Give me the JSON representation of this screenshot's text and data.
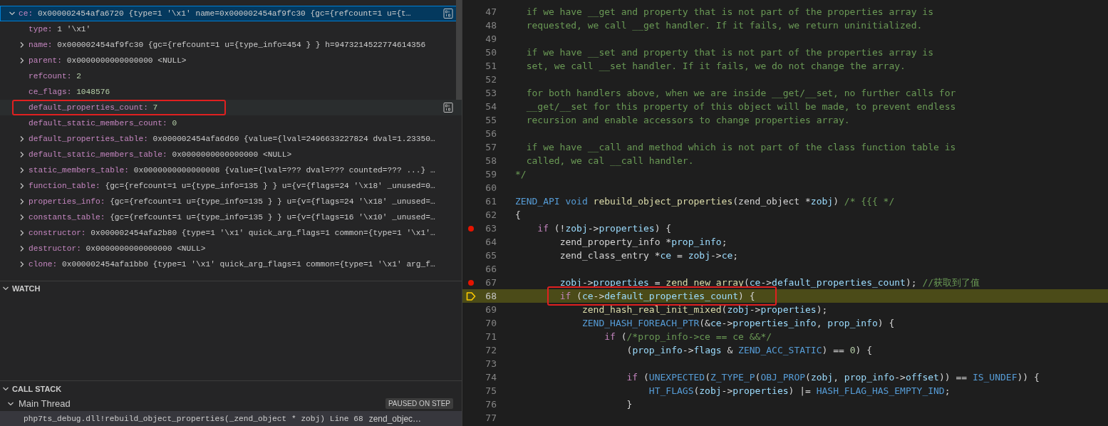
{
  "variables": {
    "items": [
      {
        "name": "ce:",
        "value": "0x000002454afa6720 {type=1 '\\x1' name=0x000002454af9fc30 {gc={refcount=1 u={t…",
        "kind": "text",
        "expandable": true,
        "expanded": true,
        "selected": true,
        "hovered": false,
        "annotated": false,
        "children": [
          {
            "name": "type:",
            "value": "1 '\\x1'",
            "kind": "text",
            "expandable": false,
            "selected": false,
            "hovered": false,
            "annotated": false
          },
          {
            "name": "name:",
            "value": "0x000002454af9fc30 {gc={refcount=1 u={type_info=454 } } h=9473214522774614356",
            "kind": "text",
            "expandable": true,
            "expanded": false,
            "selected": false,
            "hovered": false,
            "annotated": false
          },
          {
            "name": "parent:",
            "value": "0x0000000000000000 <NULL>",
            "kind": "text",
            "expandable": true,
            "expanded": false,
            "selected": false,
            "hovered": false,
            "annotated": false
          },
          {
            "name": "refcount:",
            "value": "2",
            "kind": "number",
            "expandable": false,
            "selected": false,
            "hovered": false,
            "annotated": false
          },
          {
            "name": "ce_flags:",
            "value": "1048576",
            "kind": "number",
            "expandable": false,
            "selected": false,
            "hovered": false,
            "annotated": false
          },
          {
            "name": "default_properties_count:",
            "value": "7",
            "kind": "number",
            "expandable": false,
            "selected": false,
            "hovered": true,
            "annotated": true
          },
          {
            "name": "default_static_members_count:",
            "value": "0",
            "kind": "number",
            "expandable": false,
            "selected": false,
            "hovered": false,
            "annotated": false
          },
          {
            "name": "default_properties_table:",
            "value": "0x000002454afa6d60 {value={lval=2496633227824 dval=1.23350…",
            "kind": "text",
            "expandable": true,
            "expanded": false,
            "selected": false,
            "hovered": false,
            "annotated": false
          },
          {
            "name": "default_static_members_table:",
            "value": "0x0000000000000000 <NULL>",
            "kind": "text",
            "expandable": true,
            "expanded": false,
            "selected": false,
            "hovered": false,
            "annotated": false
          },
          {
            "name": "static_members_table:",
            "value": "0x0000000000000008 {value={lval=??? dval=??? counted=??? ...} …",
            "kind": "text",
            "expandable": true,
            "expanded": false,
            "selected": false,
            "hovered": false,
            "annotated": false
          },
          {
            "name": "function_table:",
            "value": "{gc={refcount=1 u={type_info=135 } } u={v={flags=24 '\\x18' _unused=0…",
            "kind": "text",
            "expandable": true,
            "expanded": false,
            "selected": false,
            "hovered": false,
            "annotated": false
          },
          {
            "name": "properties_info:",
            "value": "{gc={refcount=1 u={type_info=135 } } u={v={flags=24 '\\x18' _unused=…",
            "kind": "text",
            "expandable": true,
            "expanded": false,
            "selected": false,
            "hovered": false,
            "annotated": false
          },
          {
            "name": "constants_table:",
            "value": "{gc={refcount=1 u={type_info=135 } } u={v={flags=16 '\\x10' _unused=…",
            "kind": "text",
            "expandable": true,
            "expanded": false,
            "selected": false,
            "hovered": false,
            "annotated": false
          },
          {
            "name": "constructor:",
            "value": "0x000002454afa2b80 {type=1 '\\x1' quick_arg_flags=1 common={type=1 '\\x1'…",
            "kind": "text",
            "expandable": true,
            "expanded": false,
            "selected": false,
            "hovered": false,
            "annotated": false
          },
          {
            "name": "destructor:",
            "value": "0x0000000000000000 <NULL>",
            "kind": "text",
            "expandable": true,
            "expanded": false,
            "selected": false,
            "hovered": false,
            "annotated": false
          },
          {
            "name": "clone:",
            "value": "0x000002454afa1bb0 {type=1 '\\x1' quick_arg_flags=1 common={type=1 '\\x1' arg_f…",
            "kind": "text",
            "expandable": true,
            "expanded": false,
            "selected": false,
            "hovered": false,
            "annotated": false
          }
        ]
      }
    ]
  },
  "watch": {
    "title": "WATCH",
    "expanded": true
  },
  "call_stack": {
    "title": "CALL STACK",
    "expanded": true,
    "threads": [
      {
        "name": "Main Thread",
        "expanded": true,
        "status": "PAUSED ON STEP",
        "frames": [
          {
            "function": "php7ts_debug.dll!rebuild_object_properties(_zend_object * zobj) Line 68",
            "file": "zend_objec…",
            "selected": true
          }
        ]
      }
    ]
  },
  "code": {
    "lines": [
      {
        "n": "47",
        "kind": "comment",
        "text": "  if we have __get and property that is not part of the properties array is",
        "breakpoint": false,
        "current": false,
        "annotated": false
      },
      {
        "n": "48",
        "kind": "comment",
        "text": "  requested, we call __get handler. If it fails, we return uninitialized.",
        "breakpoint": false,
        "current": false,
        "annotated": false
      },
      {
        "n": "49",
        "breakpoint": false,
        "current": false
      },
      {
        "n": "50",
        "kind": "comment",
        "text": "  if we have __set and property that is not part of the properties array is",
        "breakpoint": false,
        "current": false,
        "annotated": false
      },
      {
        "n": "51",
        "kind": "comment",
        "text": "  set, we call __set handler. If it fails, we do not change the array.",
        "breakpoint": false,
        "current": false,
        "annotated": false
      },
      {
        "n": "52",
        "breakpoint": false,
        "current": false
      },
      {
        "n": "53",
        "kind": "comment",
        "text": "  for both handlers above, when we are inside __get/__set, no further calls for",
        "breakpoint": false,
        "current": false,
        "annotated": false
      },
      {
        "n": "54",
        "kind": "comment",
        "text": "  __get/__set for this property of this object will be made, to prevent endless",
        "breakpoint": false,
        "current": false,
        "annotated": false
      },
      {
        "n": "55",
        "kind": "comment",
        "text": "  recursion and enable accessors to change properties array.",
        "breakpoint": false,
        "current": false,
        "annotated": false
      },
      {
        "n": "56",
        "breakpoint": false,
        "current": false
      },
      {
        "n": "57",
        "kind": "comment",
        "text": "  if we have __call and method which is not part of the class function table is",
        "breakpoint": false,
        "current": false,
        "annotated": false
      },
      {
        "n": "58",
        "kind": "comment",
        "text": "  called, we cal __call handler.",
        "breakpoint": false,
        "current": false,
        "annotated": false
      },
      {
        "n": "59",
        "kind": "comment",
        "text": "*/",
        "breakpoint": false,
        "current": false,
        "annotated": false
      },
      {
        "n": "60",
        "breakpoint": false,
        "current": false
      },
      {
        "n": "61",
        "kind": "code",
        "text": "ZEND_API void rebuild_object_properties(zend_object *zobj) /* {{{ */",
        "breakpoint": false,
        "current": false,
        "annotated": false
      },
      {
        "n": "62",
        "kind": "code",
        "text": "{",
        "breakpoint": false,
        "current": false,
        "annotated": false
      },
      {
        "n": "63",
        "kind": "code",
        "text": "    if (!zobj->properties) {",
        "breakpoint": true,
        "current": false,
        "annotated": false
      },
      {
        "n": "64",
        "kind": "code",
        "text": "        zend_property_info *prop_info;",
        "breakpoint": false,
        "current": false,
        "annotated": false
      },
      {
        "n": "65",
        "kind": "code",
        "text": "        zend_class_entry *ce = zobj->ce;",
        "breakpoint": false,
        "current": false,
        "annotated": false
      },
      {
        "n": "66",
        "breakpoint": false,
        "current": false
      },
      {
        "n": "67",
        "kind": "code",
        "text": "        zobj->properties = zend_new_array(ce->default_properties_count); //获取到了值",
        "breakpoint": true,
        "current": false,
        "annotated": false
      },
      {
        "n": "68",
        "kind": "code",
        "text": "        if (ce->default_properties_count) {",
        "breakpoint": false,
        "current": true,
        "annotated": true
      },
      {
        "n": "69",
        "kind": "code",
        "text": "            zend_hash_real_init_mixed(zobj->properties);",
        "breakpoint": false,
        "current": false,
        "annotated": false
      },
      {
        "n": "70",
        "kind": "code",
        "text": "            ZEND_HASH_FOREACH_PTR(&ce->properties_info, prop_info) {",
        "breakpoint": false,
        "current": false,
        "annotated": false
      },
      {
        "n": "71",
        "kind": "code",
        "text": "                if (/*prop_info->ce == ce &&*/",
        "breakpoint": false,
        "current": false,
        "annotated": false
      },
      {
        "n": "72",
        "kind": "code",
        "text": "                    (prop_info->flags & ZEND_ACC_STATIC) == 0) {",
        "breakpoint": false,
        "current": false,
        "annotated": false
      },
      {
        "n": "73",
        "breakpoint": false,
        "current": false
      },
      {
        "n": "74",
        "kind": "code",
        "text": "                    if (UNEXPECTED(Z_TYPE_P(OBJ_PROP(zobj, prop_info->offset)) == IS_UNDEF)) {",
        "breakpoint": false,
        "current": false,
        "annotated": false
      },
      {
        "n": "75",
        "kind": "code",
        "text": "                        HT_FLAGS(zobj->properties) |= HASH_FLAG_HAS_EMPTY_IND;",
        "breakpoint": false,
        "current": false,
        "annotated": false
      },
      {
        "n": "76",
        "kind": "code",
        "text": "                    }",
        "breakpoint": false,
        "current": false,
        "annotated": false
      },
      {
        "n": "77",
        "breakpoint": false,
        "current": false
      }
    ]
  }
}
